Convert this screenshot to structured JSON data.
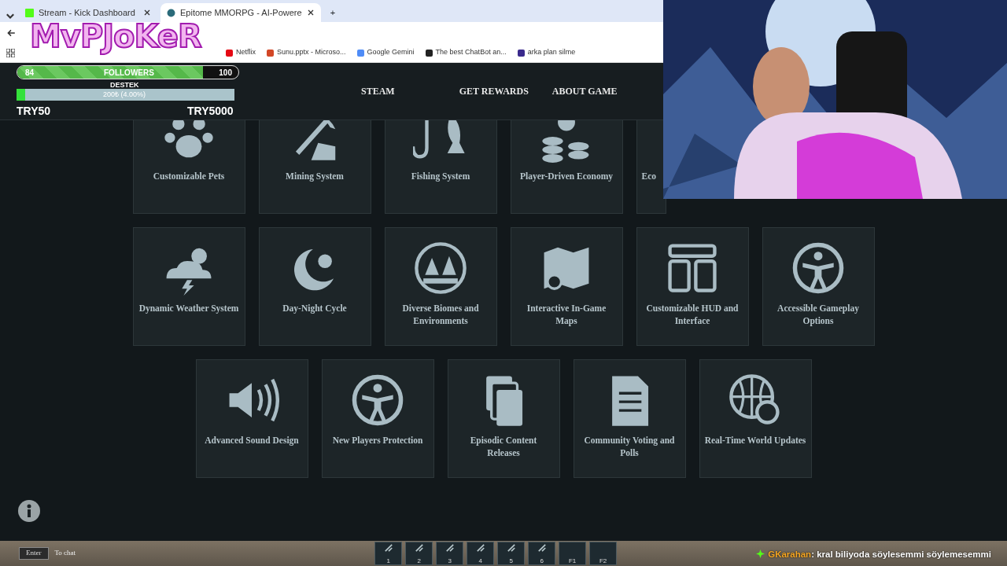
{
  "browser": {
    "tabs": [
      {
        "label": "Stream - Kick Dashboard",
        "selected": false
      },
      {
        "label": "Epitome MMORPG - AI-Powere",
        "selected": true
      }
    ],
    "new_tab": "+",
    "bookmarks": [
      {
        "label": "Netflix",
        "color": "#e50914"
      },
      {
        "label": "Sunu.pptx - Microso...",
        "color": "#d24726"
      },
      {
        "label": "Google Gemini",
        "color": "#4f8cf7"
      },
      {
        "label": "The best ChatBot an...",
        "color": "#222222"
      },
      {
        "label": "arka plan silme",
        "color": "#3a2a8c"
      }
    ]
  },
  "overlay": {
    "logo": "MvPJoKeR",
    "followers": {
      "current": "84",
      "label": "FOLLOWERS",
      "goal": "100",
      "level": 0.84
    },
    "donation": {
      "label": "DESTEK",
      "progress": "200₺ (4.00%)",
      "level": 0.04,
      "min": "TRY50",
      "max": "TRY5000"
    }
  },
  "site": {
    "nav": [
      "STEAM",
      "GET REWARDS",
      "ABOUT GAME"
    ],
    "feature_rows": [
      [
        {
          "label": "Customizable Pets"
        },
        {
          "label": "Mining System"
        },
        {
          "label": "Fishing System"
        },
        {
          "label": "Player-Driven Economy"
        },
        {
          "label": "Eco",
          "kind": "partial"
        }
      ],
      [
        {
          "label": "Dynamic Weather System"
        },
        {
          "label": "Day-Night Cycle"
        },
        {
          "label": "Diverse Biomes and Environments"
        },
        {
          "label": "Interactive In-Game Maps"
        },
        {
          "label": "Customizable HUD and Interface"
        },
        {
          "label": "Accessible Gameplay Options"
        }
      ],
      [
        {
          "label": "Advanced Sound Design"
        },
        {
          "label": "New Players Protection"
        },
        {
          "label": "Episodic Content Releases"
        },
        {
          "label": "Community Voting and Polls"
        },
        {
          "label": "Real-Time World Updates"
        }
      ]
    ]
  },
  "game": {
    "chat_key": "Enter",
    "chat_hint": "To chat",
    "hotbar": [
      "1",
      "2",
      "3",
      "4",
      "5",
      "6",
      "F1",
      "F2"
    ],
    "chat_message": {
      "user": "GKarahan",
      "text": ": kral biliyoda söylesemmi söylemesemmi"
    }
  }
}
